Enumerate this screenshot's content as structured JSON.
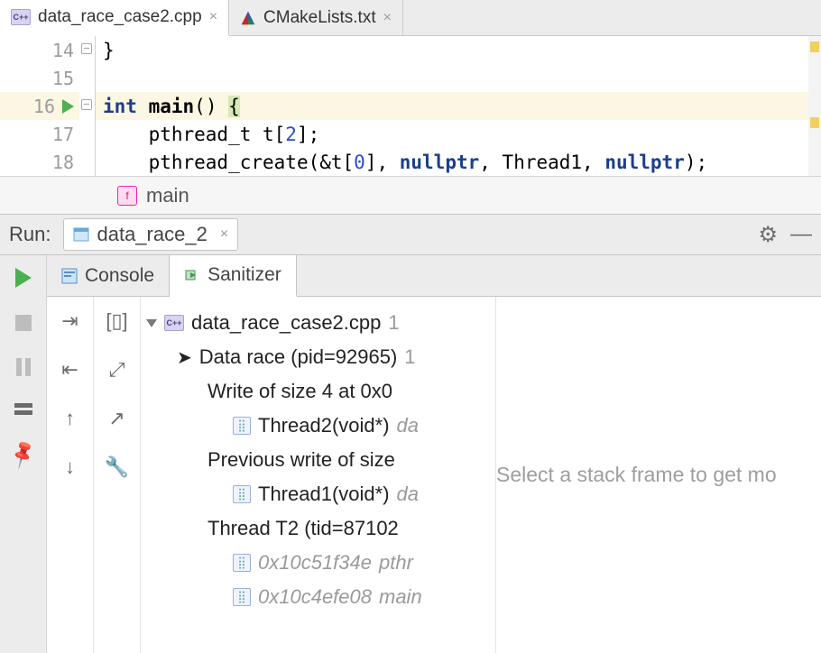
{
  "editor_tabs": {
    "file_active": "data_race_case2.cpp",
    "file_other": "CMakeLists.txt"
  },
  "gutter": {
    "l14": "14",
    "l15": "15",
    "l16": "16",
    "l17": "17",
    "l18": "18"
  },
  "code": {
    "l14": "}",
    "l16_kw_int": "int",
    "l16_fn": "main",
    "l16_rest": "() ",
    "l16_brace": "{",
    "l17_pre": "    ",
    "l17_a": "pthread_t t[",
    "l17_n": "2",
    "l17_b": "];",
    "l18_pre": "    ",
    "l18_a": "pthread_create(&t[",
    "l18_n": "0",
    "l18_b": "], ",
    "l18_kw1": "nullptr",
    "l18_c": ", Thread1, ",
    "l18_kw2": "nullptr",
    "l18_d": ");"
  },
  "breadcrumb": {
    "fn": "main"
  },
  "run_header": {
    "label": "Run:",
    "config": "data_race_2"
  },
  "panel_tabs": {
    "console": "Console",
    "sanitizer": "Sanitizer"
  },
  "tree": {
    "file": "data_race_case2.cpp",
    "file_count": "1",
    "race": "Data race (pid=92965)",
    "race_count": "1",
    "write": "Write of size 4 at 0x0",
    "t2": "Thread2(void*)",
    "t2_file": "da",
    "prev": "Previous write of size",
    "t1": "Thread1(void*)",
    "t1_file": "da",
    "thread_t2": "Thread T2 (tid=87102",
    "addr1": "0x10c51f34e",
    "addr1_lbl": "pthr",
    "addr2": "0x10c4efe08",
    "addr2_lbl": "main"
  },
  "detail": {
    "placeholder": "Select a stack frame to get mo"
  }
}
